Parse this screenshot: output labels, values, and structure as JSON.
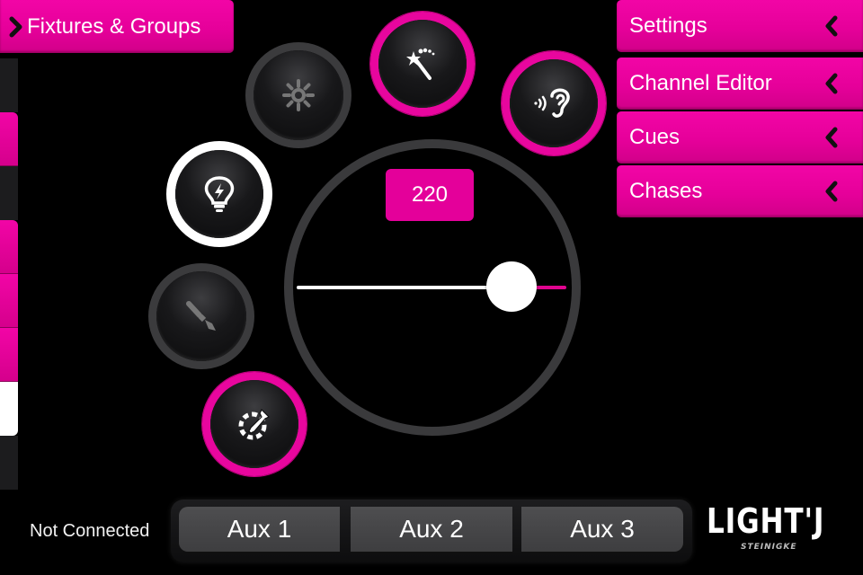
{
  "colors": {
    "accent": "#e6009a",
    "ring_gray": "#3b3b3d",
    "background": "#000000",
    "aux_button": "#464648"
  },
  "header": {
    "fixtures_label": "Fixtures & Groups",
    "fixtures_icon": "chevron-right-icon"
  },
  "menu": {
    "items": [
      {
        "label": "Settings",
        "icon": "chevron-left-icon"
      },
      {
        "label": "Channel Editor",
        "icon": "chevron-left-icon"
      },
      {
        "label": "Cues",
        "icon": "chevron-left-icon"
      },
      {
        "label": "Chases",
        "icon": "chevron-left-icon"
      }
    ]
  },
  "side_strip": {
    "segments": [
      "dark",
      "pink",
      "dark",
      "pink",
      "pink",
      "pink",
      "white",
      "dark"
    ]
  },
  "modes": [
    {
      "name": "brightness",
      "icon": "sun-icon",
      "state": "inactive"
    },
    {
      "name": "effects",
      "icon": "magic-wand-icon",
      "state": "enabled"
    },
    {
      "name": "sound",
      "icon": "ear-sound-icon",
      "state": "enabled"
    },
    {
      "name": "flash",
      "icon": "lightbulb-flash-icon",
      "state": "selected"
    },
    {
      "name": "paint",
      "icon": "paintbrush-icon",
      "state": "inactive"
    },
    {
      "name": "color-picker",
      "icon": "eyedropper-icon",
      "state": "enabled"
    }
  ],
  "dial": {
    "value": 220,
    "value_label": "220",
    "min": 0,
    "max": 255
  },
  "footer": {
    "status": "Not Connected",
    "aux_buttons": [
      "Aux 1",
      "Aux 2",
      "Aux 3"
    ],
    "logo_main": "LIGHT'J",
    "logo_sub": "STEINIGKE"
  }
}
